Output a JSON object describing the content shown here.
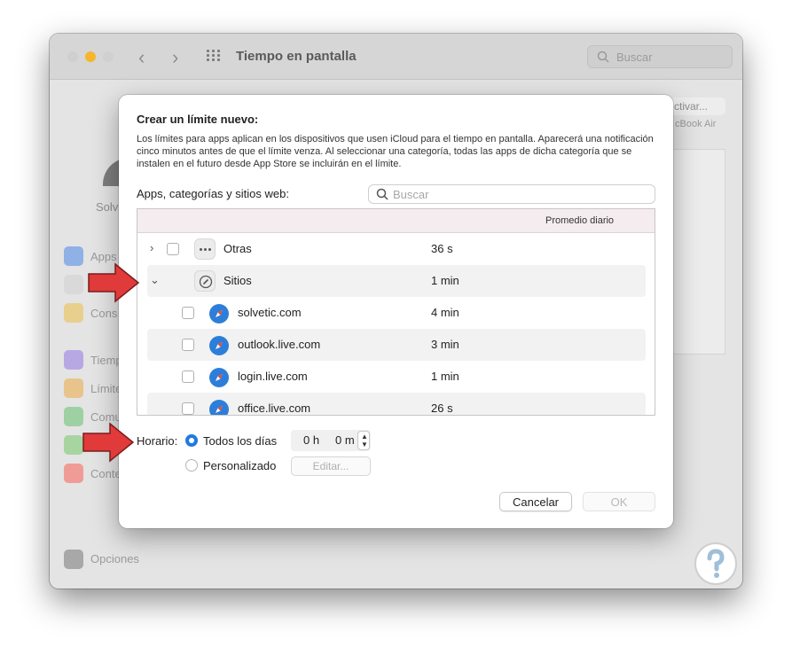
{
  "window": {
    "title": "Tiempo en pantalla",
    "search_placeholder": "Buscar",
    "account_name": "Solv",
    "right_button": "ctivar...",
    "right_caption": "cBook Air",
    "sidebar": [
      {
        "label": "Apps",
        "color": "#8fb1e6"
      },
      {
        "label": "",
        "color": "#d9d9d9"
      },
      {
        "label": "Cons",
        "color": "#e8cf8c"
      },
      {
        "label": "Tiemp",
        "color": "#b7a8e4"
      },
      {
        "label": "Límite",
        "color": "#e8c48c"
      },
      {
        "label": "Comu",
        "color": "#9fd0a3"
      },
      {
        "label": "",
        "color": "#a8d4a1"
      },
      {
        "label": "Conte",
        "color": "#f09c96"
      }
    ],
    "options_label": "Opciones"
  },
  "dialog": {
    "title": "Crear un límite nuevo:",
    "description": "Los límites para apps aplican en los dispositivos que usen iCloud para el tiempo en pantalla. Aparecerá una notificación cinco minutos antes de que el límite venza. Al seleccionar una categoría, todas las apps de dicha categoría que se instalen en el futuro desde App Store se incluirán en el límite.",
    "list_label": "Apps, categorías y sitios web:",
    "search_placeholder": "Buscar",
    "column_header": "Promedio diario",
    "rows": [
      {
        "name": "Otras",
        "time": "36 s",
        "icon": "dots-icon",
        "expand": "›"
      },
      {
        "name": "Sitios",
        "time": "1 min",
        "icon": "compass-icon",
        "expand": "⌄"
      },
      {
        "name": "solvetic.com",
        "time": "4 min",
        "icon": "safari-icon"
      },
      {
        "name": "outlook.live.com",
        "time": "3 min",
        "icon": "safari-icon"
      },
      {
        "name": "login.live.com",
        "time": "1 min",
        "icon": "safari-icon"
      },
      {
        "name": "office.live.com",
        "time": "26 s",
        "icon": "safari-icon"
      }
    ],
    "schedule": {
      "label": "Horario:",
      "every_day_label": "Todos los días",
      "custom_label": "Personalizado",
      "hours": "0 h",
      "minutes": "0 m",
      "edit_label": "Editar..."
    },
    "cancel_label": "Cancelar",
    "ok_label": "OK"
  },
  "colors": {
    "accent": "#1f7ae0",
    "arrow": "#e03a3a"
  }
}
